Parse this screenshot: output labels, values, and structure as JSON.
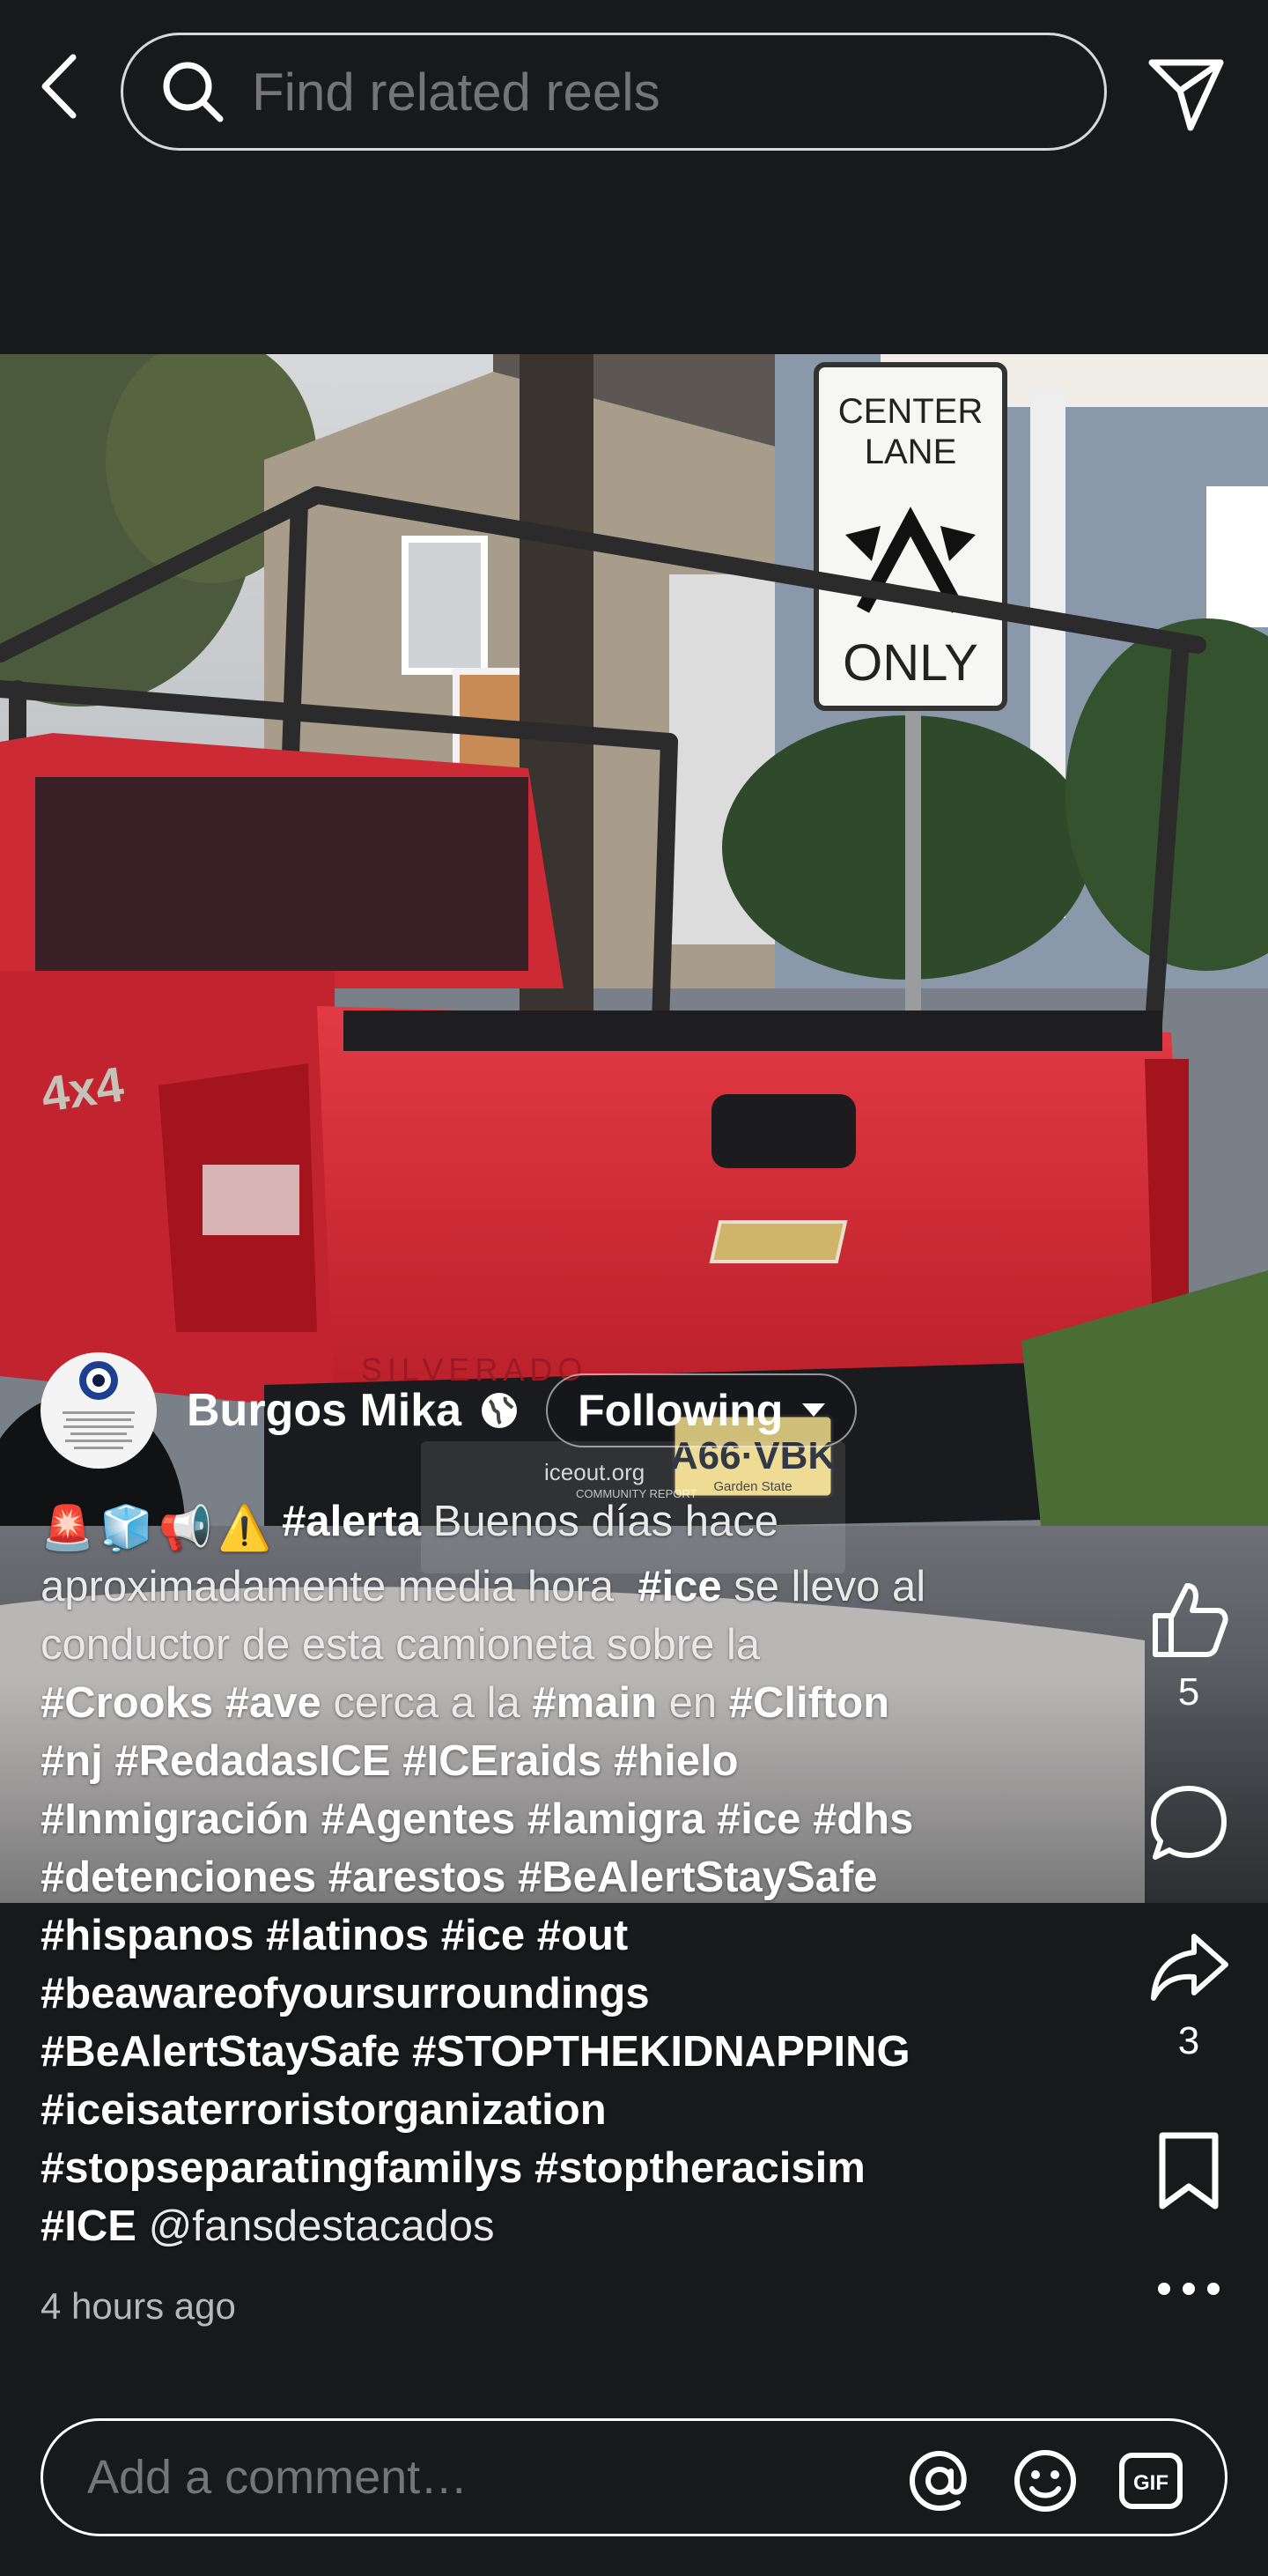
{
  "header": {
    "back_icon": "chevron-left-icon",
    "search_placeholder": "Find related reels",
    "send_icon": "send-icon"
  },
  "post": {
    "author_name": "Burgos Mika",
    "audience_icon": "globe-icon",
    "follow_label": "Following",
    "caption": {
      "emojis": [
        "🚨",
        "🧊",
        "📢",
        "⚠️"
      ],
      "lines": [
        [
          {
            "t": "tag",
            "v": "#alerta"
          },
          {
            "t": "text",
            "v": " Buenos días hace"
          }
        ],
        [
          {
            "t": "text",
            "v": "aproximadamente media hora  "
          },
          {
            "t": "tag",
            "v": "#ice"
          },
          {
            "t": "text",
            "v": " se llevo al"
          }
        ],
        [
          {
            "t": "text",
            "v": "conductor de esta camioneta sobre la"
          }
        ],
        [
          {
            "t": "tag",
            "v": "#Crooks"
          },
          {
            "t": "text",
            "v": " "
          },
          {
            "t": "tag",
            "v": "#ave"
          },
          {
            "t": "text",
            "v": " cerca a la "
          },
          {
            "t": "tag",
            "v": "#main"
          },
          {
            "t": "text",
            "v": " en "
          },
          {
            "t": "tag",
            "v": "#Clifton"
          }
        ],
        [
          {
            "t": "tag",
            "v": "#nj"
          },
          {
            "t": "text",
            "v": " "
          },
          {
            "t": "tag",
            "v": "#RedadasICE"
          },
          {
            "t": "text",
            "v": " "
          },
          {
            "t": "tag",
            "v": "#ICEraids"
          },
          {
            "t": "text",
            "v": " "
          },
          {
            "t": "tag",
            "v": "#hielo"
          }
        ],
        [
          {
            "t": "tag",
            "v": "#Inmigración"
          },
          {
            "t": "text",
            "v": " "
          },
          {
            "t": "tag",
            "v": "#Agentes"
          },
          {
            "t": "text",
            "v": " "
          },
          {
            "t": "tag",
            "v": "#lamigra"
          },
          {
            "t": "text",
            "v": " "
          },
          {
            "t": "tag",
            "v": "#ice"
          },
          {
            "t": "text",
            "v": " "
          },
          {
            "t": "tag",
            "v": "#dhs"
          }
        ],
        [
          {
            "t": "tag",
            "v": "#detenciones"
          },
          {
            "t": "text",
            "v": " "
          },
          {
            "t": "tag",
            "v": "#arestos"
          },
          {
            "t": "text",
            "v": " "
          },
          {
            "t": "tag",
            "v": "#BeAlertStaySafe"
          }
        ],
        [
          {
            "t": "tag",
            "v": "#hispanos"
          },
          {
            "t": "text",
            "v": " "
          },
          {
            "t": "tag",
            "v": "#latinos"
          },
          {
            "t": "text",
            "v": " "
          },
          {
            "t": "tag",
            "v": "#ice"
          },
          {
            "t": "text",
            "v": " "
          },
          {
            "t": "tag",
            "v": "#out"
          }
        ],
        [
          {
            "t": "tag",
            "v": "#beawareofyoursurroundings"
          }
        ],
        [
          {
            "t": "tag",
            "v": "#BeAlertStaySafe"
          },
          {
            "t": "text",
            "v": " "
          },
          {
            "t": "tag",
            "v": "#STOPTHEKIDNAPPING"
          }
        ],
        [
          {
            "t": "tag",
            "v": "#iceisaterroristorganization"
          }
        ],
        [
          {
            "t": "tag",
            "v": "#stopseparatingfamilys"
          },
          {
            "t": "text",
            "v": " "
          },
          {
            "t": "tag",
            "v": "#stoptheracisim"
          }
        ],
        [
          {
            "t": "tag",
            "v": "#ICE"
          },
          {
            "t": "text",
            "v": " "
          },
          {
            "t": "mention",
            "v": "@fansdestacados"
          }
        ]
      ]
    },
    "timestamp": "4 hours ago"
  },
  "media": {
    "sign_line1": "CENTER",
    "sign_line2": "LANE",
    "sign_line3": "ONLY",
    "badge_4x4": "4x4",
    "truck_model": "SILVERADO",
    "plate": "A66·VBK",
    "plate_state": "Garden State",
    "watermark_brand": "iceout.org",
    "watermark_sub": "COMMUNITY REPORT"
  },
  "actions": {
    "like_count": "5",
    "share_count": "3",
    "like_icon": "thumbs-up-icon",
    "comment_icon": "comment-bubble-icon",
    "share_icon": "share-arrow-icon",
    "save_icon": "bookmark-icon",
    "more_icon": "more-dots-icon"
  },
  "comment_bar": {
    "placeholder": "Add a comment…",
    "mention_icon": "at-sign-icon",
    "emoji_icon": "smiley-icon",
    "gif_icon": "gif-icon",
    "gif_label": "GIF"
  },
  "colors": {
    "background": "#18191b",
    "truck_red": "#d32a36",
    "text_primary": "#ffffff"
  }
}
